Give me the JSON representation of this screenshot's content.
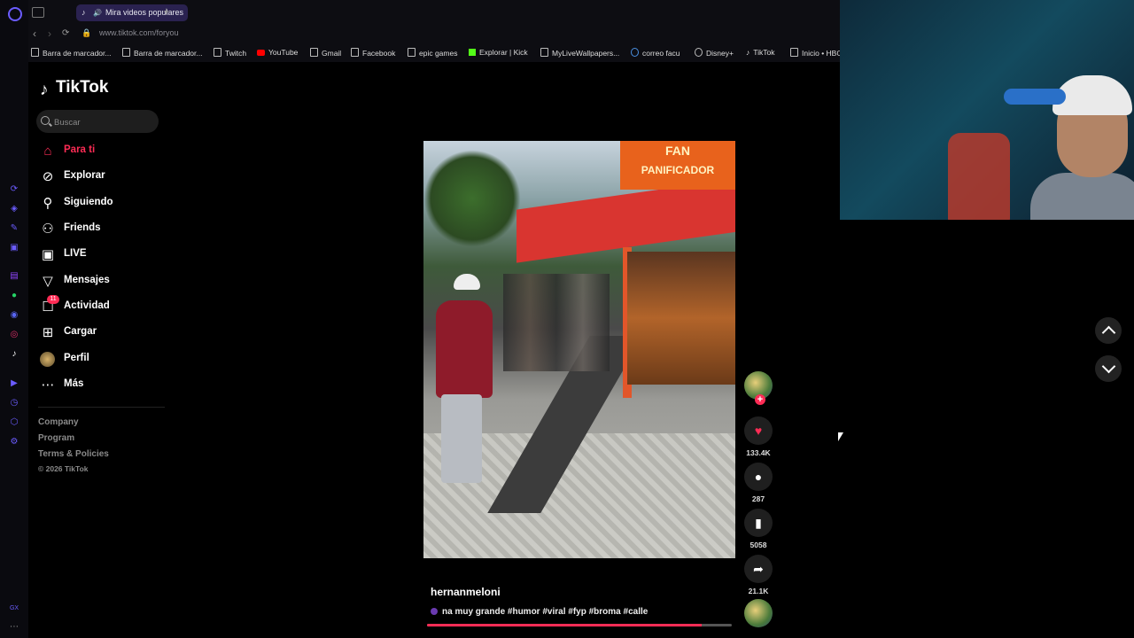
{
  "browser": {
    "tab_title": "Mira videos populares",
    "url": "www.tiktok.com/foryou",
    "bookmarks": [
      {
        "label": "Barra de marcador...",
        "icon": "folder-icon"
      },
      {
        "label": "Barra de marcador...",
        "icon": "folder-icon"
      },
      {
        "label": "Twitch",
        "icon": "page-icon"
      },
      {
        "label": "YouTube",
        "icon": "youtube-icon"
      },
      {
        "label": "Gmail",
        "icon": "page-icon"
      },
      {
        "label": "Facebook",
        "icon": "page-icon"
      },
      {
        "label": "epic games",
        "icon": "page-icon"
      },
      {
        "label": "Explorar | Kick",
        "icon": "kick-icon"
      },
      {
        "label": "MyLiveWallpapers...",
        "icon": "page-icon"
      },
      {
        "label": "correo facu",
        "icon": "globe-icon"
      },
      {
        "label": "Disney+",
        "icon": "disney-icon"
      },
      {
        "label": "TikTok",
        "icon": "tiktok-icon"
      },
      {
        "label": "Inicio • HBO",
        "icon": "page-icon"
      }
    ]
  },
  "tiktok": {
    "logo": "TikTok",
    "search": {
      "placeholder": "Buscar"
    },
    "nav": [
      {
        "label": "Para ti",
        "icon": "home-icon"
      },
      {
        "label": "Explorar",
        "icon": "compass-icon"
      },
      {
        "label": "Siguiendo",
        "icon": "user-follow-icon"
      },
      {
        "label": "Friends",
        "icon": "friends-icon"
      },
      {
        "label": "LIVE",
        "icon": "live-icon"
      },
      {
        "label": "Mensajes",
        "icon": "send-icon"
      },
      {
        "label": "Actividad",
        "icon": "inbox-icon",
        "badge": "11"
      },
      {
        "label": "Cargar",
        "icon": "upload-icon"
      },
      {
        "label": "Perfil",
        "icon": "profile-avatar-icon"
      },
      {
        "label": "Más",
        "icon": "more-icon"
      }
    ],
    "footer": {
      "links": [
        "Company",
        "Program",
        "Terms & Policies"
      ],
      "copyright": "© 2026 TikTok"
    }
  },
  "video": {
    "author": "hernanmeloni",
    "description": "na muy grande #humor #viral #fyp #broma #calle",
    "sign_text": "PANIFICADOR",
    "sign_text_top": "FAN",
    "progress": 0.9,
    "likes": "133.4K",
    "comments": "287",
    "saves": "5058",
    "shares": "21.1K"
  },
  "colors": {
    "accent": "#fe2c55",
    "background": "#000000",
    "opera": "#6b5cff"
  }
}
